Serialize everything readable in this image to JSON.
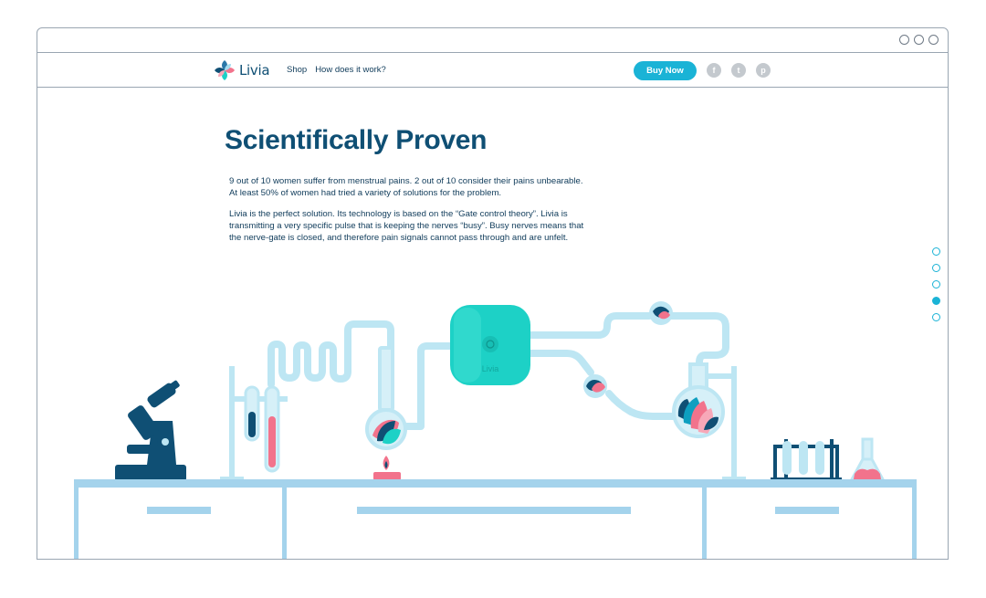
{
  "brand": {
    "name": "Livia"
  },
  "nav": {
    "links": [
      "Shop",
      "How does it work?"
    ],
    "buy_label": "Buy Now"
  },
  "socials": [
    {
      "icon": "facebook-icon",
      "glyph": "f"
    },
    {
      "icon": "twitter-icon",
      "glyph": "t"
    },
    {
      "icon": "pinterest-icon",
      "glyph": "p"
    }
  ],
  "hero": {
    "title": "Scientifically Proven",
    "paragraph1": "9 out of 10 women suffer from menstrual pains. 2 out of 10 consider their pains unbearable. At least 50% of women had tried a variety of solutions for the problem.",
    "paragraph2": "Livia is the perfect solution. Its technology is based on the “Gate control theory”. Livia is transmitting a very specific pulse that is keeping the nerves “busy”. Busy nerves means that the nerve-gate is closed, and therefore pain signals cannot pass through and are unfelt."
  },
  "device": {
    "label": "Livia"
  },
  "pager": {
    "count": 5,
    "active_index": 3
  },
  "colors": {
    "accent": "#1ab3d6",
    "navy": "#0f4f74",
    "device": "#1dd1c6",
    "pipe": "#bde6f3",
    "pink": "#f2738c"
  }
}
